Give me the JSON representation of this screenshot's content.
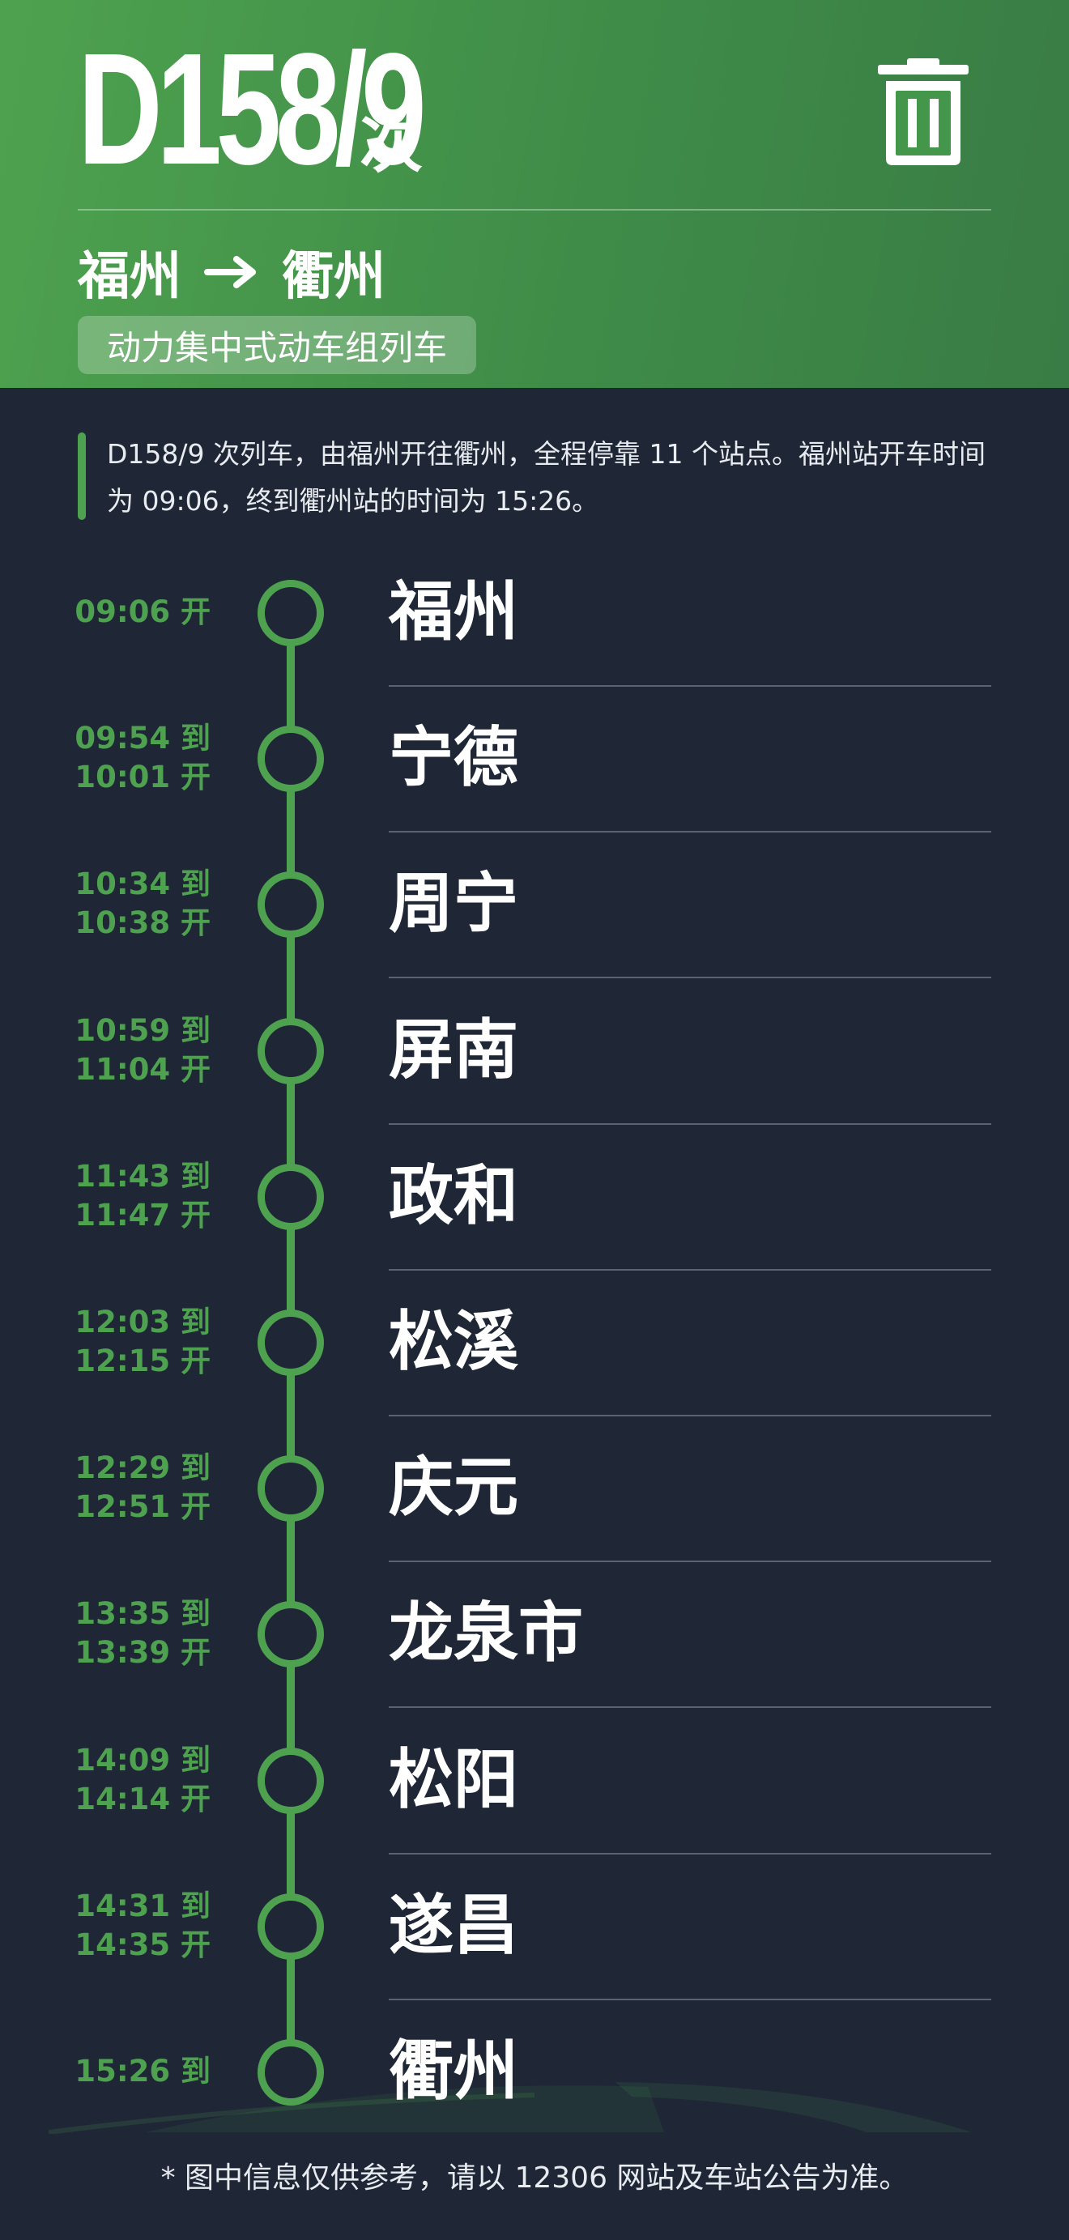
{
  "header": {
    "train_number": "D158/9",
    "train_suffix": "次",
    "origin": "福州",
    "destination": "衢州",
    "train_type": "动力集中式动车组列车",
    "delete_icon": "trash-icon",
    "route_arrow_icon": "arrow-right-icon"
  },
  "summary": "D158/9 次列车，由福州开往衢州，全程停靠 11 个站点。福州站开车时间为 09:06，终到衢州站的时间为 15:26。",
  "stations": [
    {
      "name": "福州",
      "times": [
        "09:06 开"
      ]
    },
    {
      "name": "宁德",
      "times": [
        "09:54 到",
        "10:01 开"
      ]
    },
    {
      "name": "周宁",
      "times": [
        "10:34 到",
        "10:38 开"
      ]
    },
    {
      "name": "屏南",
      "times": [
        "10:59 到",
        "11:04 开"
      ]
    },
    {
      "name": "政和",
      "times": [
        "11:43 到",
        "11:47 开"
      ]
    },
    {
      "name": "松溪",
      "times": [
        "12:03 到",
        "12:15 开"
      ]
    },
    {
      "name": "庆元",
      "times": [
        "12:29 到",
        "12:51 开"
      ]
    },
    {
      "name": "龙泉市",
      "times": [
        "13:35 到",
        "13:39 开"
      ]
    },
    {
      "name": "松阳",
      "times": [
        "14:09 到",
        "14:14 开"
      ]
    },
    {
      "name": "遂昌",
      "times": [
        "14:31 到",
        "14:35 开"
      ]
    },
    {
      "name": "衢州",
      "times": [
        "15:26 到"
      ]
    }
  ],
  "footer": "* 图中信息仅供参考，请以 12306 网站及车站公告为准。",
  "colors": {
    "accent": "#4ea24f",
    "background": "#1f2736",
    "text": "#ffffff"
  }
}
